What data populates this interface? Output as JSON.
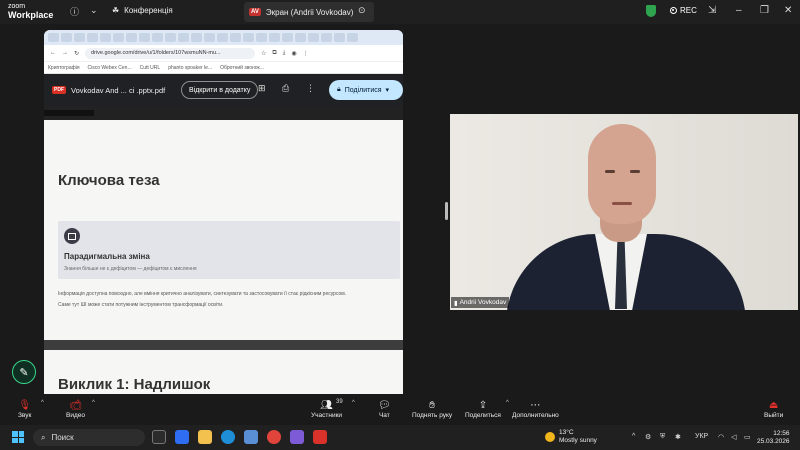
{
  "zoom": {
    "logo_line1": "zoom",
    "logo_line2": "Workplace",
    "meeting_label": "Конференція",
    "share_tab_badge": "AV",
    "share_tab_label": "Экран (Andrii Vovkodav)",
    "rec_label": "REC"
  },
  "browser": {
    "url": "drive.google.com/drive/u/1/folders/107wsmuNN-mu...",
    "bookmarks": [
      "Криптографія",
      "Cisco Webex Cen...",
      "Cutt URL",
      "phanto spoaker le...",
      "Обротний звонок..."
    ]
  },
  "drive": {
    "file_badge": "PDF",
    "file_name": "Vovkodav And ... ci .pptx.pdf",
    "open_with_label": "Відкрити в додатку",
    "share_label": "Поділитися"
  },
  "slide": {
    "title": "Ключова теза",
    "card_title": "Парадигмальна зміна",
    "card_subtitle": "Знання більше не є дефіцитом — дефіцитом є мислення",
    "body_line1": "Інформація доступна повсюдно, але вміння критично аналізувати, синтезувати та застосовувати її стає рідкісним ресурсом.",
    "body_line2": "Саме тут ШІ може стати потужним інструментом трансформації освіти.",
    "next_title": "Виклик 1: Надлишок"
  },
  "participant": {
    "name": "Andrii Vovkodav"
  },
  "toolbar": {
    "audio": "Звук",
    "video": "Видео",
    "participants": "Участники",
    "participants_count": "39",
    "chat": "Чат",
    "raise_hand": "Поднять руку",
    "share": "Поделиться",
    "more": "Дополнительно",
    "leave": "Выйти"
  },
  "taskbar": {
    "search_placeholder": "Поиск",
    "weather_temp": "13°C",
    "weather_desc": "Mostly sunny",
    "lang": "УКР",
    "time": "12:56",
    "date": "25.03.2026"
  },
  "colors": {
    "accent_green": "#3ad58a",
    "leave_red": "#e5302c",
    "share_blue": "#c2e7ff"
  }
}
